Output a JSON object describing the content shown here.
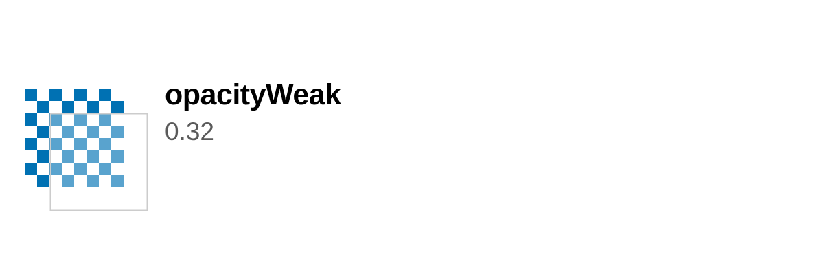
{
  "token": {
    "name": "opacityWeak",
    "value": "0.32",
    "opacity": 0.32
  },
  "swatch": {
    "icon": "opacity-swatch-icon",
    "checker_color": "#0071b3",
    "frame_color": "#cccccc"
  }
}
